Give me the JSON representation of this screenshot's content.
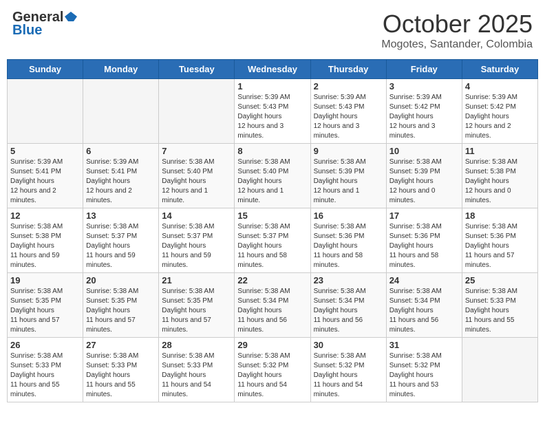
{
  "header": {
    "logo_general": "General",
    "logo_blue": "Blue",
    "month_title": "October 2025",
    "location": "Mogotes, Santander, Colombia"
  },
  "days_of_week": [
    "Sunday",
    "Monday",
    "Tuesday",
    "Wednesday",
    "Thursday",
    "Friday",
    "Saturday"
  ],
  "weeks": [
    [
      {
        "day": "",
        "empty": true
      },
      {
        "day": "",
        "empty": true
      },
      {
        "day": "",
        "empty": true
      },
      {
        "day": "1",
        "sunrise": "5:39 AM",
        "sunset": "5:43 PM",
        "daylight": "12 hours and 3 minutes."
      },
      {
        "day": "2",
        "sunrise": "5:39 AM",
        "sunset": "5:43 PM",
        "daylight": "12 hours and 3 minutes."
      },
      {
        "day": "3",
        "sunrise": "5:39 AM",
        "sunset": "5:42 PM",
        "daylight": "12 hours and 3 minutes."
      },
      {
        "day": "4",
        "sunrise": "5:39 AM",
        "sunset": "5:42 PM",
        "daylight": "12 hours and 2 minutes."
      }
    ],
    [
      {
        "day": "5",
        "sunrise": "5:39 AM",
        "sunset": "5:41 PM",
        "daylight": "12 hours and 2 minutes."
      },
      {
        "day": "6",
        "sunrise": "5:39 AM",
        "sunset": "5:41 PM",
        "daylight": "12 hours and 2 minutes."
      },
      {
        "day": "7",
        "sunrise": "5:38 AM",
        "sunset": "5:40 PM",
        "daylight": "12 hours and 1 minute."
      },
      {
        "day": "8",
        "sunrise": "5:38 AM",
        "sunset": "5:40 PM",
        "daylight": "12 hours and 1 minute."
      },
      {
        "day": "9",
        "sunrise": "5:38 AM",
        "sunset": "5:39 PM",
        "daylight": "12 hours and 1 minute."
      },
      {
        "day": "10",
        "sunrise": "5:38 AM",
        "sunset": "5:39 PM",
        "daylight": "12 hours and 0 minutes."
      },
      {
        "day": "11",
        "sunrise": "5:38 AM",
        "sunset": "5:38 PM",
        "daylight": "12 hours and 0 minutes."
      }
    ],
    [
      {
        "day": "12",
        "sunrise": "5:38 AM",
        "sunset": "5:38 PM",
        "daylight": "11 hours and 59 minutes."
      },
      {
        "day": "13",
        "sunrise": "5:38 AM",
        "sunset": "5:37 PM",
        "daylight": "11 hours and 59 minutes."
      },
      {
        "day": "14",
        "sunrise": "5:38 AM",
        "sunset": "5:37 PM",
        "daylight": "11 hours and 59 minutes."
      },
      {
        "day": "15",
        "sunrise": "5:38 AM",
        "sunset": "5:37 PM",
        "daylight": "11 hours and 58 minutes."
      },
      {
        "day": "16",
        "sunrise": "5:38 AM",
        "sunset": "5:36 PM",
        "daylight": "11 hours and 58 minutes."
      },
      {
        "day": "17",
        "sunrise": "5:38 AM",
        "sunset": "5:36 PM",
        "daylight": "11 hours and 58 minutes."
      },
      {
        "day": "18",
        "sunrise": "5:38 AM",
        "sunset": "5:36 PM",
        "daylight": "11 hours and 57 minutes."
      }
    ],
    [
      {
        "day": "19",
        "sunrise": "5:38 AM",
        "sunset": "5:35 PM",
        "daylight": "11 hours and 57 minutes."
      },
      {
        "day": "20",
        "sunrise": "5:38 AM",
        "sunset": "5:35 PM",
        "daylight": "11 hours and 57 minutes."
      },
      {
        "day": "21",
        "sunrise": "5:38 AM",
        "sunset": "5:35 PM",
        "daylight": "11 hours and 57 minutes."
      },
      {
        "day": "22",
        "sunrise": "5:38 AM",
        "sunset": "5:34 PM",
        "daylight": "11 hours and 56 minutes."
      },
      {
        "day": "23",
        "sunrise": "5:38 AM",
        "sunset": "5:34 PM",
        "daylight": "11 hours and 56 minutes."
      },
      {
        "day": "24",
        "sunrise": "5:38 AM",
        "sunset": "5:34 PM",
        "daylight": "11 hours and 56 minutes."
      },
      {
        "day": "25",
        "sunrise": "5:38 AM",
        "sunset": "5:33 PM",
        "daylight": "11 hours and 55 minutes."
      }
    ],
    [
      {
        "day": "26",
        "sunrise": "5:38 AM",
        "sunset": "5:33 PM",
        "daylight": "11 hours and 55 minutes."
      },
      {
        "day": "27",
        "sunrise": "5:38 AM",
        "sunset": "5:33 PM",
        "daylight": "11 hours and 55 minutes."
      },
      {
        "day": "28",
        "sunrise": "5:38 AM",
        "sunset": "5:33 PM",
        "daylight": "11 hours and 54 minutes."
      },
      {
        "day": "29",
        "sunrise": "5:38 AM",
        "sunset": "5:32 PM",
        "daylight": "11 hours and 54 minutes."
      },
      {
        "day": "30",
        "sunrise": "5:38 AM",
        "sunset": "5:32 PM",
        "daylight": "11 hours and 54 minutes."
      },
      {
        "day": "31",
        "sunrise": "5:38 AM",
        "sunset": "5:32 PM",
        "daylight": "11 hours and 53 minutes."
      },
      {
        "day": "",
        "empty": true
      }
    ]
  ]
}
